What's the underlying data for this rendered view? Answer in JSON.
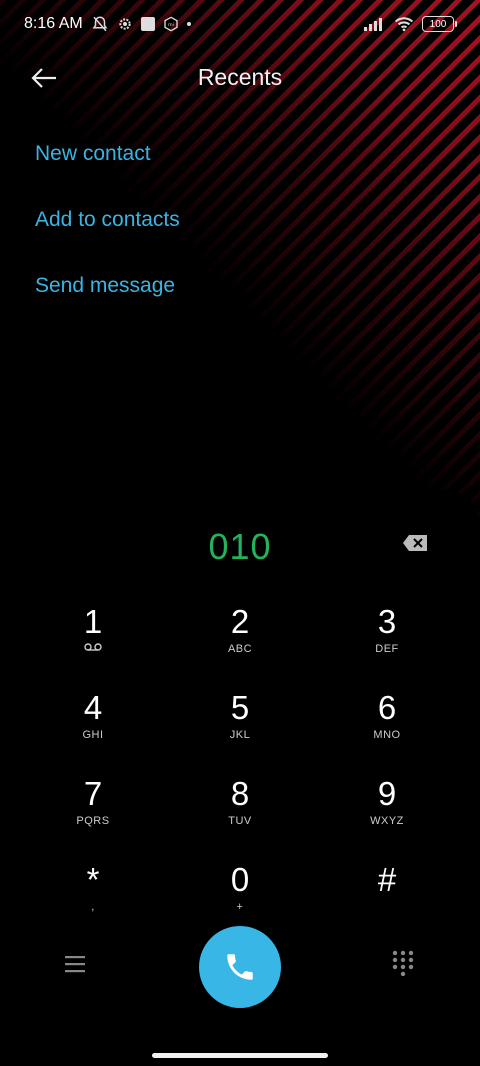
{
  "status_bar": {
    "time": "8:16 AM",
    "battery": "100",
    "icons_left": [
      "mute-alarm-icon",
      "settings-icon",
      "square-icon",
      "mi-icon",
      "dot-icon"
    ],
    "icons_right": [
      "signal-icon",
      "wifi-icon",
      "battery-icon"
    ]
  },
  "header": {
    "title": "Recents",
    "back_icon": "back-arrow-icon"
  },
  "options": [
    {
      "label": "New contact"
    },
    {
      "label": "Add to contacts"
    },
    {
      "label": "Send message"
    }
  ],
  "dialpad": {
    "number": "010",
    "number_color": "#22b35c",
    "backspace_icon": "backspace-icon",
    "keys": [
      [
        {
          "digit": "1",
          "letters": ""
        },
        {
          "digit": "2",
          "letters": "ABC"
        },
        {
          "digit": "3",
          "letters": "DEF"
        }
      ],
      [
        {
          "digit": "4",
          "letters": "GHI"
        },
        {
          "digit": "5",
          "letters": "JKL"
        },
        {
          "digit": "6",
          "letters": "MNO"
        }
      ],
      [
        {
          "digit": "7",
          "letters": "PQRS"
        },
        {
          "digit": "8",
          "letters": "TUV"
        },
        {
          "digit": "9",
          "letters": "WXYZ"
        }
      ],
      [
        {
          "digit": "*",
          "letters": ","
        },
        {
          "digit": "0",
          "letters": "+"
        },
        {
          "digit": "#",
          "letters": ""
        }
      ]
    ]
  },
  "bottom_bar": {
    "menu_icon": "menu-icon",
    "call_icon": "phone-icon",
    "dialpad_icon": "dialpad-icon",
    "call_color": "#38b6e6"
  },
  "accent_color": "#39b4e4"
}
